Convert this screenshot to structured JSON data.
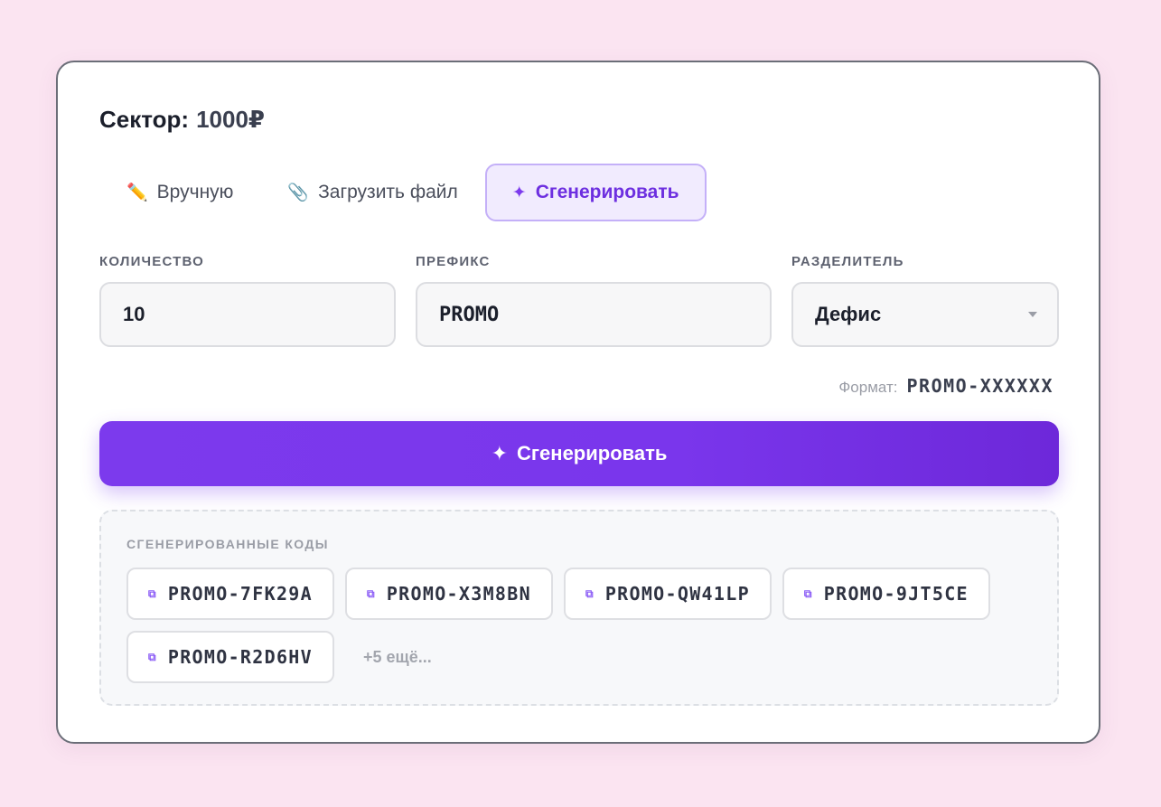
{
  "header": {
    "title_label": "Сектор:",
    "title_value": "1000₽"
  },
  "tabs": [
    {
      "icon": "pencil-icon",
      "glyph": "✏️",
      "label": "Вручную",
      "active": false
    },
    {
      "icon": "paperclip-icon",
      "glyph": "📎",
      "label": "Загрузить файл",
      "active": false
    },
    {
      "icon": "sparkle-icon",
      "glyph": "✦",
      "label": "Сгенерировать",
      "active": true
    }
  ],
  "form": {
    "quantity": {
      "label": "КОЛИЧЕСТВО",
      "value": "10"
    },
    "prefix": {
      "label": "ПРЕФИКС",
      "value": "PROMO"
    },
    "separator": {
      "label": "РАЗДЕЛИТЕЛЬ",
      "value": "Дефис"
    }
  },
  "format": {
    "label": "Формат:",
    "value": "PROMO-XXXXXX"
  },
  "generate_button": {
    "icon": "sparkle-icon",
    "glyph": "✦",
    "label": "Сгенерировать"
  },
  "results": {
    "label": "СГЕНЕРИРОВАННЫЕ КОДЫ",
    "codes": [
      "PROMO-7FK29A",
      "PROMO-X3M8BN",
      "PROMO-QW41LP",
      "PROMO-9JT5CE",
      "PROMO-R2D6HV"
    ],
    "copy_icon_glyph": "⧉",
    "more_label": "+5 ещё..."
  },
  "colors": {
    "accent": "#7c3aed",
    "accent_light": "#f1ebfe",
    "background": "#fbe4f1"
  }
}
